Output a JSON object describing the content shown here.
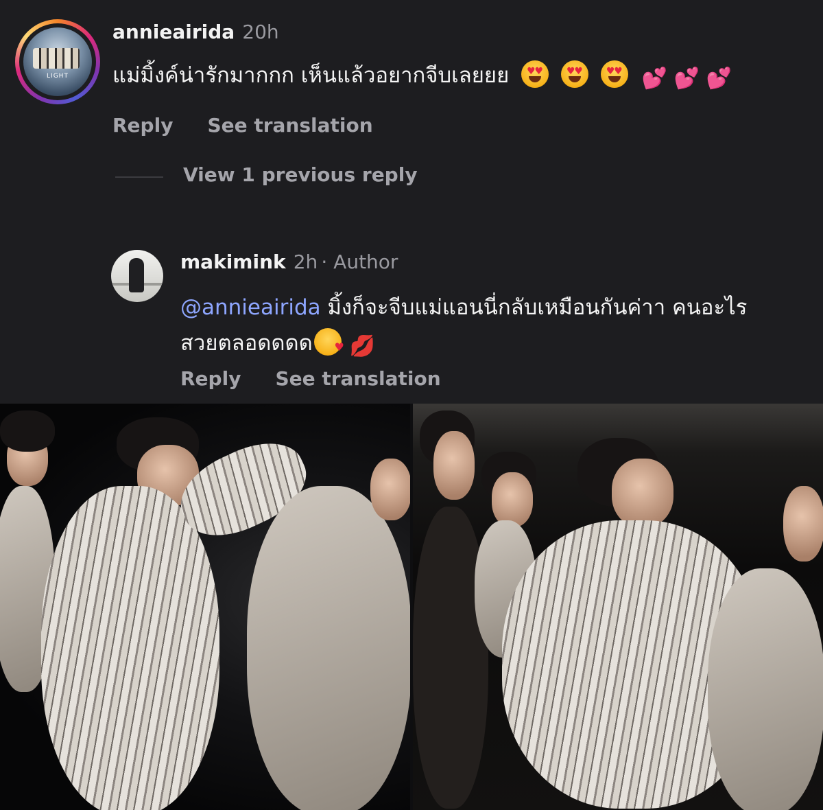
{
  "comment1": {
    "username": "annieairida",
    "time": "20h",
    "text": "แม่มิ้งค์น่ารักมากกก เห็นแล้วอยากจีบเลยยย",
    "hearts": "💕 💕 💕",
    "avatar_caption": "LIGHT",
    "actions": {
      "reply": "Reply",
      "translate": "See translation"
    }
  },
  "view_previous": "View 1 previous reply",
  "comment2": {
    "username": "makimink",
    "time": "2h",
    "author_tag": "· Author",
    "mention": "@annieairida",
    "text_line1": "มิ้งก็จะจีบแม่แอนนี่กลับเหมือนกันค่าา คนอะไร",
    "text_line2": "สวยตลอดดดด",
    "lips": "💋",
    "actions": {
      "reply": "Reply",
      "translate": "See translation"
    }
  },
  "colors": {
    "background": "#1d1d20",
    "text": "#f4f4f4",
    "muted": "#9a9aa0",
    "mention": "#8ea6ff"
  },
  "icons": [
    "heart-eyes-emoji",
    "two-hearts-emoji",
    "kiss-emoji",
    "lips-emoji"
  ]
}
